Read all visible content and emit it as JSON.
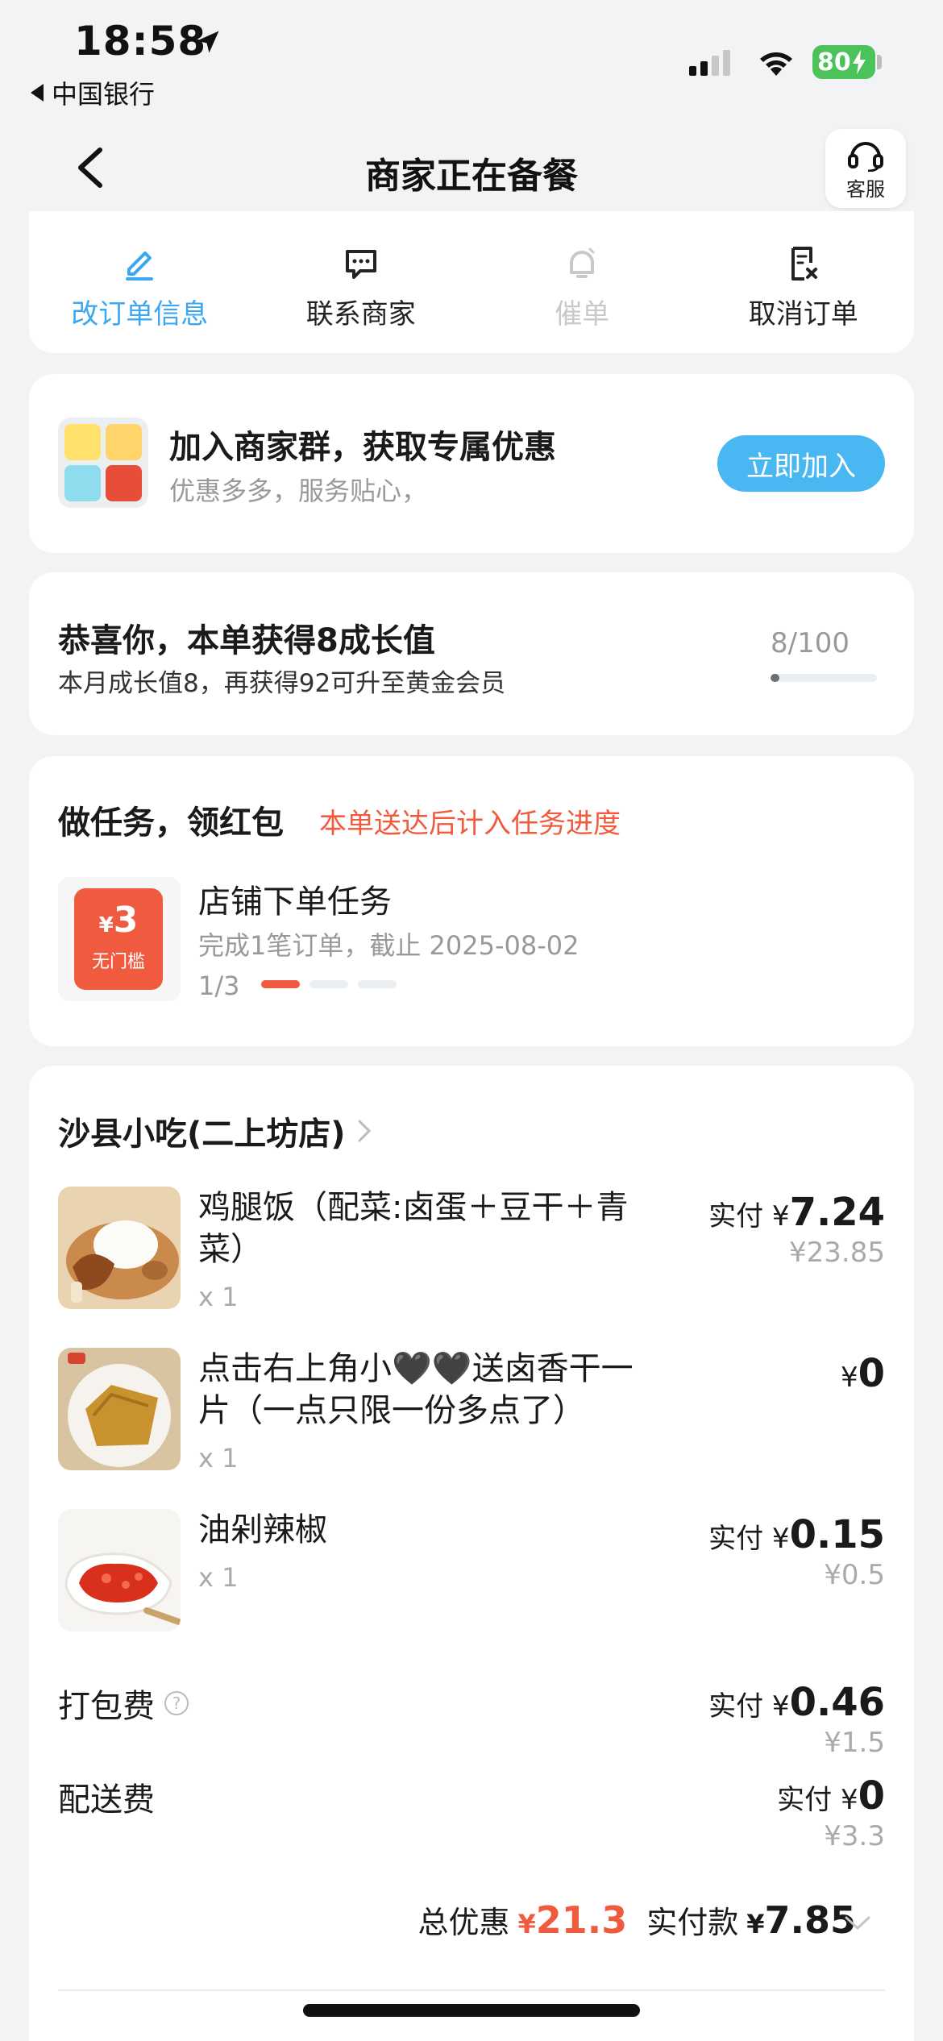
{
  "status_bar": {
    "time": "18:58",
    "back_app": "中国银行",
    "battery": "80"
  },
  "header": {
    "title": "商家正在备餐",
    "customer_service": "客服"
  },
  "actions": [
    {
      "label": "改订单信息",
      "icon": "edit-icon"
    },
    {
      "label": "联系商家",
      "icon": "chat-icon"
    },
    {
      "label": "催单",
      "icon": "bell-icon"
    },
    {
      "label": "取消订单",
      "icon": "cancel-order-icon"
    }
  ],
  "group_banner": {
    "title": "加入商家群，获取专属优惠",
    "subtitle": "优惠多多，服务贴心，",
    "button": "立即加入"
  },
  "growth": {
    "title": "恭喜你，本单获得8成长值",
    "subtitle": "本月成长值8，再获得92可升至黄金会员",
    "count": "8/100",
    "progress": 0.08
  },
  "task": {
    "title": "做任务，领红包",
    "note": "本单送达后计入任务进度",
    "coupon_symbol": "¥",
    "coupon_amount": "3",
    "coupon_label": "无门槛",
    "name": "店铺下单任务",
    "desc": "完成1笔订单，截止 2025-08-02",
    "progress_text": "1/3",
    "progress_done": 1,
    "progress_total": 3
  },
  "order": {
    "shop_name": "沙县小吃(二上坊店)",
    "items": [
      {
        "name": "鸡腿饭（配菜:卤蛋＋豆干＋青菜）",
        "qty": "x 1",
        "pay_label": "实付",
        "pay_currency": "¥",
        "pay_value": "7.24",
        "original": "¥23.85"
      },
      {
        "name": "点击右上角小🖤🖤送卤香干一片（一点只限一份多点了）",
        "qty": "x 1",
        "pay_label": "",
        "pay_currency": "¥",
        "pay_value": "0",
        "original": ""
      },
      {
        "name": "油剁辣椒",
        "qty": "x 1",
        "pay_label": "实付",
        "pay_currency": "¥",
        "pay_value": "0.15",
        "original": "¥0.5"
      }
    ],
    "fees": [
      {
        "label": "打包费",
        "pay_label": "实付",
        "pay_currency": "¥",
        "pay_value": "0.46",
        "original": "¥1.5"
      },
      {
        "label": "配送费",
        "pay_label": "实付",
        "pay_currency": "¥",
        "pay_value": "0",
        "original": "¥3.3"
      }
    ],
    "total": {
      "discount_label": "总优惠",
      "discount_currency": "¥",
      "discount_value": "21.3",
      "paid_label": "实付款",
      "paid_currency": "¥",
      "paid_value": "7.85"
    }
  },
  "colors": {
    "accent_blue": "#49b7f2",
    "accent_red": "#f05a3e",
    "background": "#f2f3f5"
  }
}
